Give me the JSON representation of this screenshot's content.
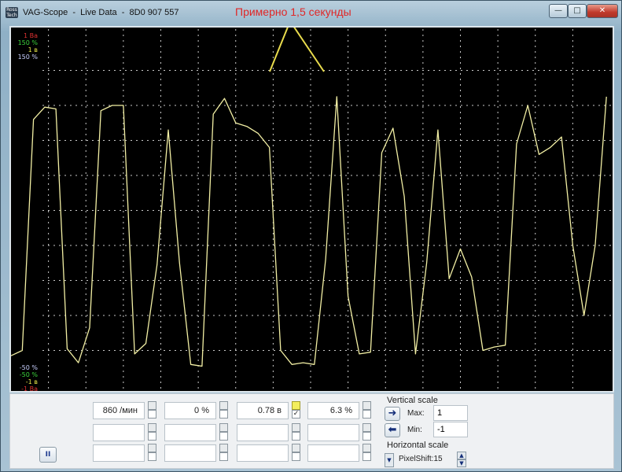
{
  "window": {
    "title": "VAG-Scope  -  Live Data  -  8D0 907 557",
    "app_icon": "Ross\nTech",
    "annotation": "Примерно 1,5 секунды",
    "buttons": {
      "minimize": "—",
      "maximize": "□",
      "close": "✕"
    }
  },
  "scope": {
    "y_labels_top": [
      {
        "text": "1 Ва",
        "color": "#e03131"
      },
      {
        "text": "150 %",
        "color": "#3cd33c"
      },
      {
        "text": "1 в",
        "color": "#e8e84a"
      },
      {
        "text": "150 %",
        "color": "#c9d0ff"
      }
    ],
    "y_labels_bottom": [
      {
        "text": "-50 %",
        "color": "#c9d0ff"
      },
      {
        "text": "-50 %",
        "color": "#3cd33c"
      },
      {
        "text": "-1 в",
        "color": "#e8e84a"
      },
      {
        "text": "-1 Ва",
        "color": "#e03131"
      }
    ],
    "colors": {
      "trace": "#f2efa4",
      "grid": "#c9c9c9",
      "annotation": "#e9dc4d",
      "background": "#000000"
    },
    "vertical_range": [
      -1,
      1
    ]
  },
  "chart_data": {
    "type": "line",
    "title": "",
    "xlabel": "",
    "ylabel": "",
    "ylim": [
      -1,
      1
    ],
    "x_range": [
      0,
      80
    ],
    "grid": true,
    "series": [
      {
        "x": [
          0,
          1.5,
          3,
          4.5,
          6,
          7.5,
          9,
          10.5,
          12,
          13.5,
          15,
          16.5,
          18,
          19.5,
          21,
          22.5,
          24,
          25.5,
          27,
          28.5,
          30,
          31.5,
          33,
          34.5,
          36,
          37.5,
          39,
          40.5,
          42,
          43.5,
          45,
          46.5,
          48,
          49.5,
          51,
          52.5,
          54,
          55.5,
          57,
          58.5,
          60,
          61.5,
          63,
          64.5,
          66,
          67.5,
          69,
          70.5,
          72,
          73.5,
          75,
          76.5,
          78,
          79.5
        ],
        "values": [
          -0.83,
          -0.8,
          0.52,
          0.59,
          0.58,
          -0.79,
          -0.87,
          -0.67,
          0.57,
          0.6,
          0.6,
          -0.82,
          -0.76,
          -0.31,
          0.46,
          -0.3,
          -0.88,
          -0.89,
          0.55,
          0.64,
          0.5,
          0.48,
          0.44,
          0.36,
          -0.8,
          -0.88,
          -0.87,
          -0.88,
          -0.28,
          0.65,
          -0.49,
          -0.82,
          -0.81,
          0.33,
          0.47,
          0.08,
          -0.82,
          -0.3,
          0.46,
          -0.39,
          -0.22,
          -0.38,
          -0.8,
          -0.78,
          -0.77,
          0.38,
          0.6,
          0.32,
          0.36,
          0.42,
          -0.2,
          -0.6,
          -0.2,
          0.65
        ]
      }
    ]
  },
  "controls": {
    "row1": [
      {
        "value": "860 /мин",
        "checked": false
      },
      {
        "value": "0 %",
        "checked": false
      },
      {
        "value": "0.78 в",
        "checked": true
      },
      {
        "value": "6.3 %",
        "checked": false
      }
    ],
    "row2": [
      "",
      "",
      "",
      ""
    ],
    "row3": [
      "",
      "",
      "",
      ""
    ],
    "vertical_scale": {
      "label": "Vertical scale",
      "max_label": "Max:",
      "max_value": "1",
      "min_label": "Min:",
      "min_value": "-1"
    },
    "horizontal_scale": {
      "label": "Horizontal scale",
      "pixel_shift": "PixelShift:15"
    },
    "pause_label": "II"
  }
}
